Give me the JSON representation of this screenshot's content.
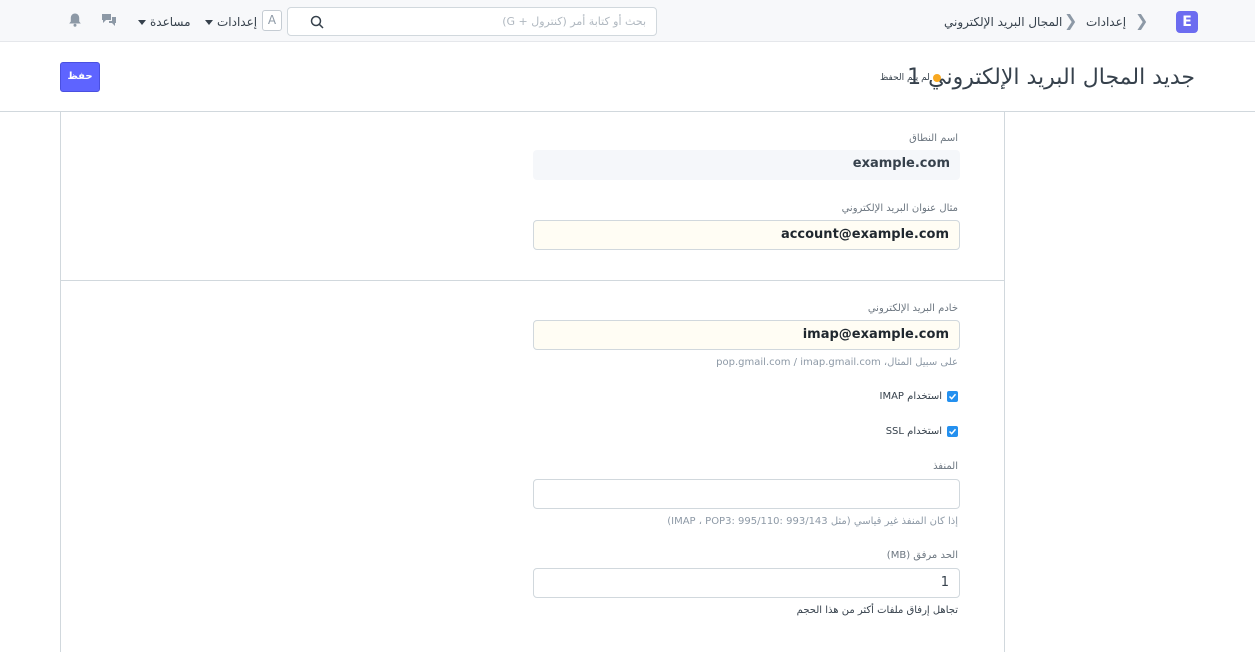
{
  "navbar": {
    "logo_letter": "E",
    "breadcrumbs": [
      "إعدادات",
      "المجال البريد الإلكتروني"
    ],
    "search_placeholder": "بحث أو كتابة أمر (كنترول + G)",
    "avatar_letter": "A",
    "settings_label": "إعدادات",
    "help_label": "مساعدة",
    "icons": [
      "chat-icon",
      "bell-icon"
    ]
  },
  "page": {
    "title": "جديد المجال البريد الإلكتروني 1",
    "indicator": "لم يتم الحفظ",
    "indicator_color": "#f8a820",
    "save_label": "حفظ",
    "accent_color": "#5e64ff"
  },
  "form": {
    "domain_name": {
      "label": "اسم النطاق",
      "value": "example.com"
    },
    "email_id": {
      "label": "مثال عنوان البريد الإلكتروني",
      "value": "account@example.com"
    },
    "email_server": {
      "label": "خادم البريد الإلكتروني",
      "value": "imap@example.com",
      "help": "على سبيل المثال، pop.gmail.com / imap.gmail.com"
    },
    "use_imap": {
      "label": "استخدام IMAP",
      "checked": true
    },
    "use_ssl": {
      "label": "استخدام SSL",
      "checked": true
    },
    "port": {
      "label": "المنفذ",
      "value": "",
      "help": "إذا كان المنفذ غير قياسي (مثل 993/143 :IMAP ، POP3: 995/110)"
    },
    "attachment_limit": {
      "label": "الحد مرفق (MB)",
      "value": "1",
      "help": "تجاهل إرفاق ملفات أكثر من هذا الحجم"
    }
  }
}
